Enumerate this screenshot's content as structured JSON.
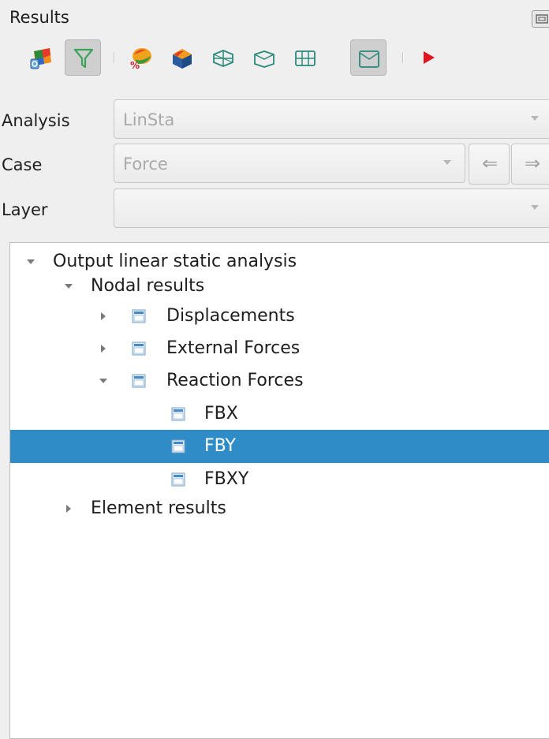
{
  "panel": {
    "title": "Results",
    "float_button_icon": "float-dock-icon"
  },
  "toolbar": {
    "buttons": [
      {
        "name": "contour-settings-icon",
        "pressed": false
      },
      {
        "name": "filter-icon",
        "pressed": true
      },
      {
        "name": "contour-percent-icon",
        "pressed": false
      },
      {
        "name": "contour-3d-icon",
        "pressed": false
      },
      {
        "name": "deformed-mesh-icon",
        "pressed": false
      },
      {
        "name": "undeformed-mesh-icon",
        "pressed": false
      },
      {
        "name": "mesh-outline-icon",
        "pressed": false
      },
      {
        "name": "mesh-boundary-icon",
        "pressed": true
      },
      {
        "name": "play-animation-icon",
        "pressed": false
      }
    ],
    "colors": {
      "accent_red": "#e0141e",
      "contour_orange": "#f08a1a"
    }
  },
  "form": {
    "analysis": {
      "label": "Analysis",
      "value": "LinSta"
    },
    "case": {
      "label": "Case",
      "value": "Force",
      "prev_label": "⇐",
      "next_label": "⇒"
    },
    "layer": {
      "label": "Layer",
      "value": ""
    }
  },
  "tree": {
    "root": {
      "label": "Output linear static analysis",
      "expanded": true
    },
    "nodal": {
      "label": "Nodal results",
      "expanded": true
    },
    "displacements": {
      "label": "Displacements",
      "expanded": false
    },
    "external_forces": {
      "label": "External Forces",
      "expanded": false
    },
    "reaction_forces": {
      "label": "Reaction Forces",
      "expanded": true
    },
    "fbx": {
      "label": "FBX"
    },
    "fby": {
      "label": "FBY",
      "selected": true
    },
    "fbxy": {
      "label": "FBXY"
    },
    "element": {
      "label": "Element results",
      "expanded": false
    },
    "colors": {
      "selection": "#308cc6"
    }
  }
}
